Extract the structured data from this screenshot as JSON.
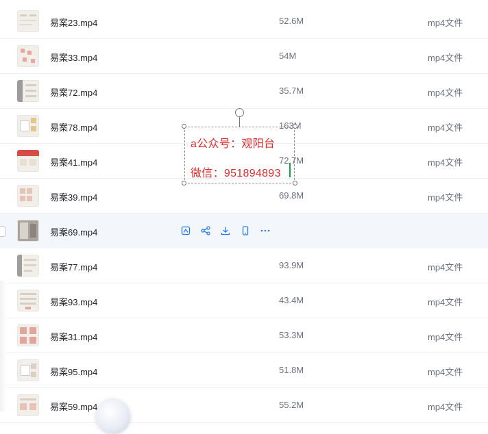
{
  "files": [
    {
      "name": "易案23.mp4",
      "size": "52.6M",
      "type": "mp4文件"
    },
    {
      "name": "易案33.mp4",
      "size": "54M",
      "type": "mp4文件"
    },
    {
      "name": "易案72.mp4",
      "size": "35.7M",
      "type": "mp4文件"
    },
    {
      "name": "易案78.mp4",
      "size": "163M",
      "type": "mp4文件"
    },
    {
      "name": "易案41.mp4",
      "size": "72.7M",
      "type": "mp4文件"
    },
    {
      "name": "易案39.mp4",
      "size": "69.8M",
      "type": "mp4文件"
    },
    {
      "name": "易案69.mp4",
      "size": "",
      "type": ""
    },
    {
      "name": "易案77.mp4",
      "size": "93.9M",
      "type": "mp4文件"
    },
    {
      "name": "易案93.mp4",
      "size": "43.4M",
      "type": "mp4文件"
    },
    {
      "name": "易案31.mp4",
      "size": "53.3M",
      "type": "mp4文件"
    },
    {
      "name": "易案95.mp4",
      "size": "51.8M",
      "type": "mp4文件"
    },
    {
      "name": "易案59.mp4",
      "size": "55.2M",
      "type": "mp4文件"
    }
  ],
  "hover_row_actions": [
    "save-to-drive-icon",
    "share-icon",
    "download-icon",
    "phone-icon",
    "more-icon"
  ],
  "annotation": {
    "line1": "a公众号：观阳台",
    "line2": "微信：951894893",
    "text_color": "#e02a2a"
  },
  "colors": {
    "accent": "#2b7de9",
    "hover_row": "#f3f6fb"
  }
}
